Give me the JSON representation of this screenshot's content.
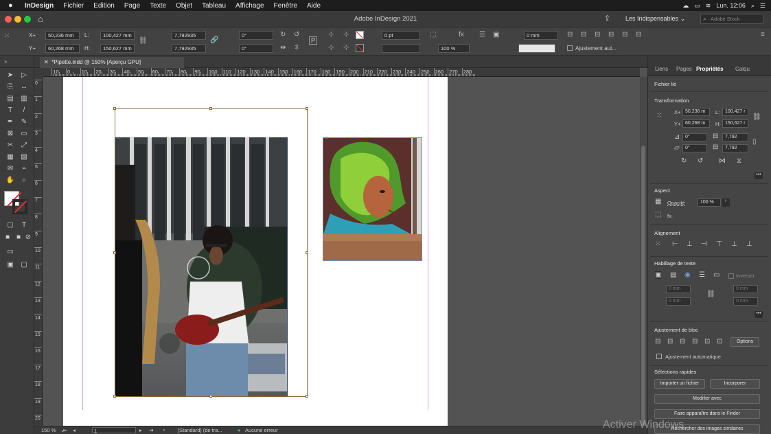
{
  "menubar": {
    "items": [
      "InDesign",
      "Fichier",
      "Edition",
      "Page",
      "Texte",
      "Objet",
      "Tableau",
      "Affichage",
      "Fenêtre",
      "Aide"
    ],
    "clock": "Lun. 12:06"
  },
  "titlebar": {
    "title": "Adobe InDesign 2021",
    "workspace": "Les Indispensables",
    "stock_placeholder": "Adobe Stock"
  },
  "control": {
    "x_label": "X+",
    "x_value": "50,236 mm",
    "y_label": "Y+",
    "y_value": "60,268 mm",
    "w_label": "L:",
    "w_value": "100,427 mm",
    "h_label": "H:",
    "h_value": "150,627 mm",
    "scale_x": "7,792935",
    "scale_y": "7,792935",
    "rotate": "0°",
    "shear": "0°",
    "stroke": "0 pt",
    "opacity": "100 %",
    "gap": "0 mm",
    "auto_fit": "Ajustement aut..."
  },
  "doc_tab": {
    "label": "*Pipette.indd @ 150% [Aperçu GPU]"
  },
  "ruler": {
    "h_labels": [
      "10",
      "0",
      "10",
      "20",
      "30",
      "40",
      "50",
      "60",
      "70",
      "80",
      "90",
      "100",
      "110",
      "120",
      "130",
      "140",
      "150",
      "160",
      "170",
      "180",
      "190",
      "200",
      "210",
      "220",
      "230",
      "240",
      "250",
      "260",
      "270",
      "280"
    ],
    "v_labels": [
      "0",
      "1",
      "2",
      "3",
      "4",
      "5",
      "6",
      "7",
      "8",
      "9",
      "10",
      "11",
      "12",
      "13",
      "14",
      "15",
      "16",
      "17",
      "18",
      "19",
      "20"
    ]
  },
  "panel": {
    "tabs": [
      "Liens",
      "Pages",
      "Propriétés",
      "Calqu"
    ],
    "linked_file": "Fichier lié",
    "transform_title": "Transformation",
    "x_value": "50,236 m",
    "y_value": "60,268 m",
    "w_value": "100,427 r",
    "h_value": "150,627 r",
    "rot": "0°",
    "shear": "0°",
    "scale_x": "7,792",
    "scale_y": "7,792",
    "aspect_title": "Aspect",
    "opacity_label": "Opacité",
    "opacity_value": "100 %",
    "fx": "fx.",
    "align_title": "Alignement",
    "wrap_title": "Habillage de texte",
    "invert_label": "Inverser",
    "wrap_values": [
      "0 mm",
      "0 mm",
      "0 mm",
      "0 mm"
    ],
    "fit_title": "Ajustement de bloc",
    "options_btn": "Options",
    "auto_fit_label": "Ajustement automatique",
    "quick_title": "Sélections rapides",
    "import_btn": "Importer un fichier",
    "embed_btn": "Incorporer",
    "edit_with_btn": "Modifier avec",
    "finder_btn": "Faire apparaître dans le Finder",
    "similar_btn": "Rechercher des images similaires"
  },
  "status": {
    "zoom": "150 %",
    "page": "1",
    "style": "[Standard] (de tra...",
    "errors": "Aucune erreur"
  },
  "watermark": "Activer Windows",
  "colors": {
    "accent": "#3b7bd6",
    "ok": "#3fbf3f",
    "margin": "#d99fe0"
  }
}
